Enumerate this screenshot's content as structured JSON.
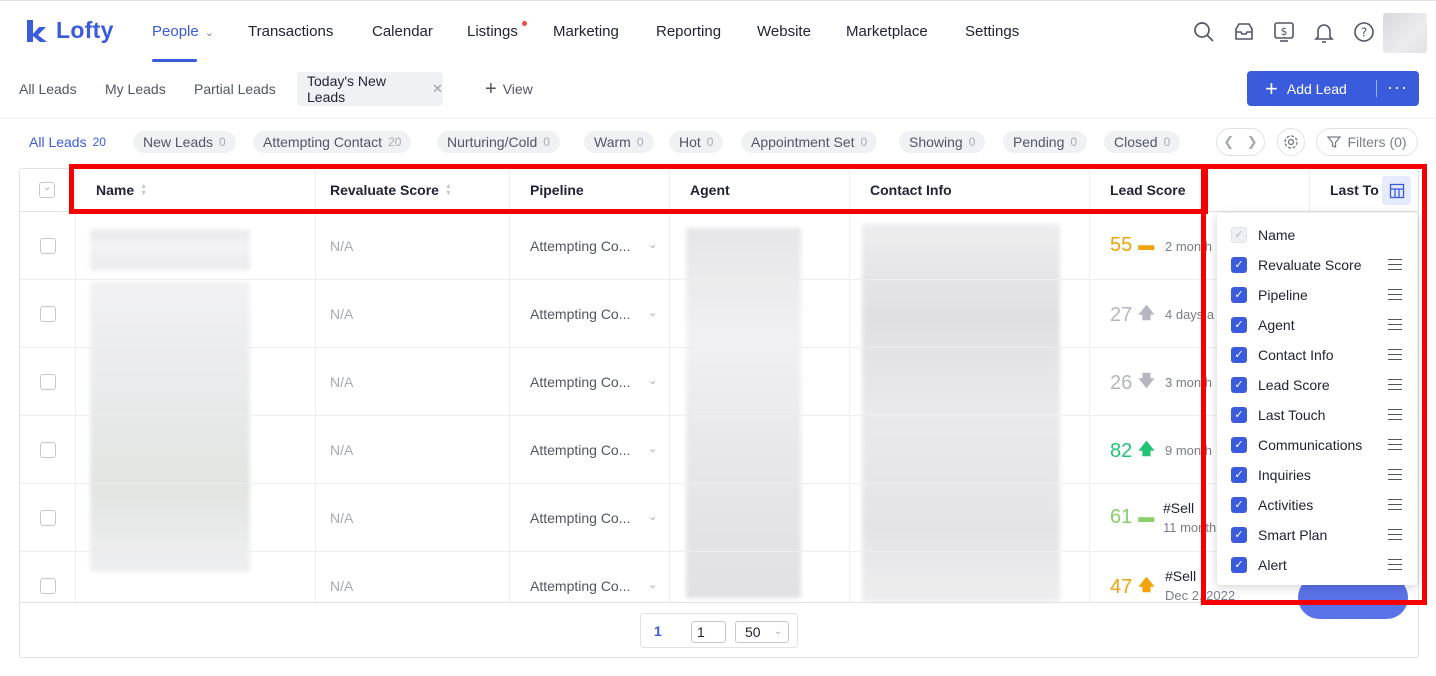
{
  "brand": {
    "name": "Lofty",
    "accent": "#3a5bdc"
  },
  "nav": {
    "items": [
      {
        "label": "People",
        "active": true
      },
      {
        "label": "Transactions"
      },
      {
        "label": "Calendar"
      },
      {
        "label": "Listings"
      },
      {
        "label": "Marketing"
      },
      {
        "label": "Reporting"
      },
      {
        "label": "Website"
      },
      {
        "label": "Marketplace"
      },
      {
        "label": "Settings"
      }
    ],
    "icons": [
      "search-icon",
      "inbox-icon",
      "dollar-icon",
      "bell-icon",
      "help-icon"
    ]
  },
  "subtabs": {
    "items": [
      "All Leads",
      "My Leads",
      "Partial Leads"
    ],
    "active": "Today's New Leads",
    "view_label": "View",
    "add_lead_label": "Add Lead"
  },
  "chips": [
    {
      "label": "All Leads",
      "count": "20"
    },
    {
      "label": "New Leads",
      "count": "0"
    },
    {
      "label": "Attempting Contact",
      "count": "20"
    },
    {
      "label": "Nurturing/Cold",
      "count": "0"
    },
    {
      "label": "Warm",
      "count": "0"
    },
    {
      "label": "Hot",
      "count": "0"
    },
    {
      "label": "Appointment Set",
      "count": "0"
    },
    {
      "label": "Showing",
      "count": "0"
    },
    {
      "label": "Pending",
      "count": "0"
    },
    {
      "label": "Closed",
      "count": "0"
    }
  ],
  "filters_label": "Filters (0)",
  "table": {
    "headers": [
      "Name",
      "Revaluate Score",
      "Pipeline",
      "Agent",
      "Contact Info",
      "Lead Score",
      "Last To"
    ],
    "rows": [
      {
        "revaluate": "N/A",
        "pipeline": "Attempting Co...",
        "score": "55",
        "trend": "flat",
        "score_color": "#f0a30a",
        "last": "2 month"
      },
      {
        "revaluate": "N/A",
        "pipeline": "Attempting Co...",
        "score": "27",
        "trend": "up",
        "score_color": "#b4b7c0",
        "last": "4 days a"
      },
      {
        "revaluate": "N/A",
        "pipeline": "Attempting Co...",
        "score": "26",
        "trend": "down",
        "score_color": "#b4b7c0",
        "last": "3 month"
      },
      {
        "revaluate": "N/A",
        "pipeline": "Attempting Co...",
        "score": "82",
        "trend": "up",
        "score_color": "#20c472",
        "last": "9 month"
      },
      {
        "revaluate": "N/A",
        "pipeline": "Attempting Co...",
        "score": "61",
        "trend": "flat",
        "score_color": "#87d068",
        "tag": "#Sell",
        "last": "11 month"
      },
      {
        "revaluate": "N/A",
        "pipeline": "Attempting Co...",
        "score": "47",
        "trend": "up",
        "score_color": "#f0a30a",
        "tag": "#Sell",
        "last": "Dec 2, 2022"
      }
    ]
  },
  "pagination": {
    "current": "1",
    "goto": "1",
    "page_size": "50"
  },
  "column_picker": {
    "items": [
      {
        "label": "Name",
        "locked": true
      },
      {
        "label": "Revaluate Score"
      },
      {
        "label": "Pipeline"
      },
      {
        "label": "Agent"
      },
      {
        "label": "Contact Info"
      },
      {
        "label": "Lead Score"
      },
      {
        "label": "Last Touch"
      },
      {
        "label": "Communications"
      },
      {
        "label": "Inquiries"
      },
      {
        "label": "Activities"
      },
      {
        "label": "Smart Plan"
      },
      {
        "label": "Alert"
      }
    ]
  }
}
